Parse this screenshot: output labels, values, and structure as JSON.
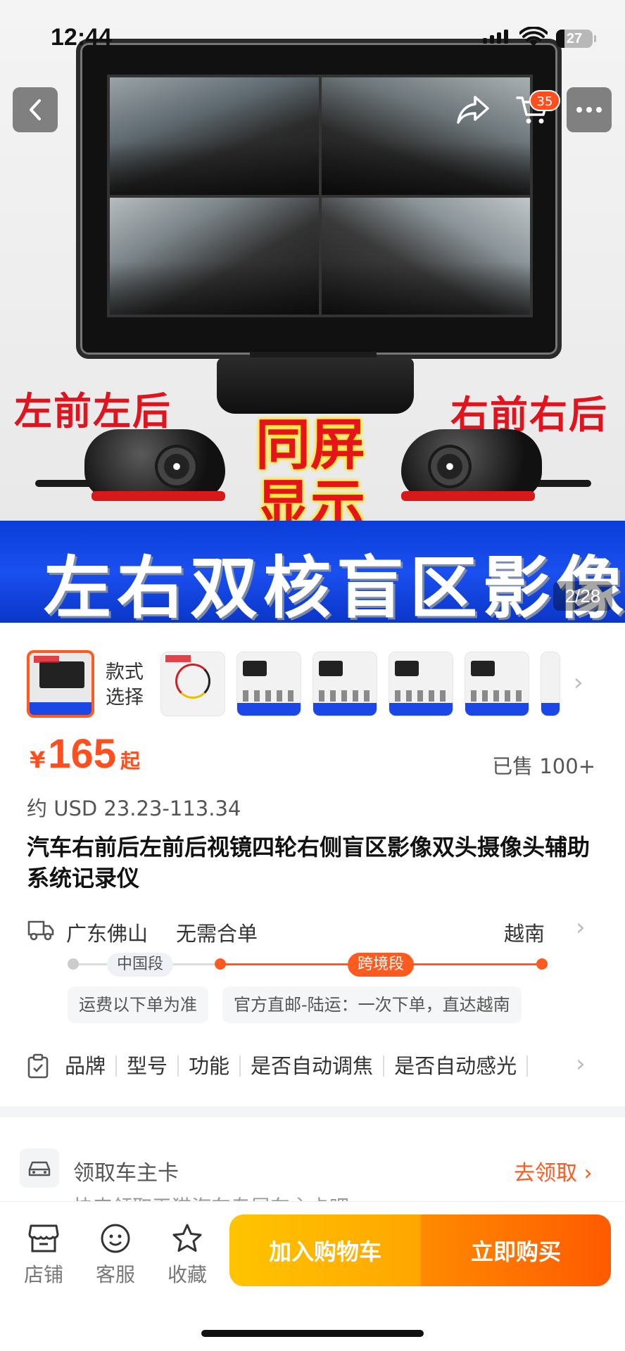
{
  "status_bar": {
    "time": "12:44",
    "battery": "27"
  },
  "top_nav": {
    "cart_count": "35"
  },
  "hero": {
    "left_label": "左前左后",
    "right_label": "右前右后",
    "center_label_line1": "同屏",
    "center_label_line2": "显示",
    "banner_text": "左右双核盲区影像",
    "page_indicator": "2/28"
  },
  "variants": {
    "style_label": "款式\n选择"
  },
  "price": {
    "currency": "¥",
    "amount": "165",
    "suffix": "起",
    "sold": "已售 100+",
    "usd": "约 USD 23.23-113.34"
  },
  "product": {
    "title": "汽车右前后左前后视镜四轮右侧盲区影像双头摄像头辅助系统记录仪"
  },
  "shipping": {
    "origin": "广东佛山",
    "no_combine": "无需合单",
    "destination": "越南",
    "segment_china": "中国段",
    "segment_cross": "跨境段",
    "note_fee": "运费以下单为准",
    "note_direct": "官方直邮-陆运：一次下单，直达越南"
  },
  "attributes": [
    "品牌",
    "型号",
    "功能",
    "是否自动调焦",
    "是否自动感光"
  ],
  "owner_card": {
    "label": "领取车主卡",
    "action": "去领取",
    "sub": "快来领取天猫汽车专属车主卡吧"
  },
  "bottom_bar": {
    "shop": "店铺",
    "service": "客服",
    "favorite": "收藏",
    "add_to_cart": "加入购物车",
    "buy_now": "立即购买"
  },
  "colors": {
    "accent": "#ff5a1f",
    "banner_blue": "#1a4ff0",
    "cart_yellow": "#ffb800"
  }
}
